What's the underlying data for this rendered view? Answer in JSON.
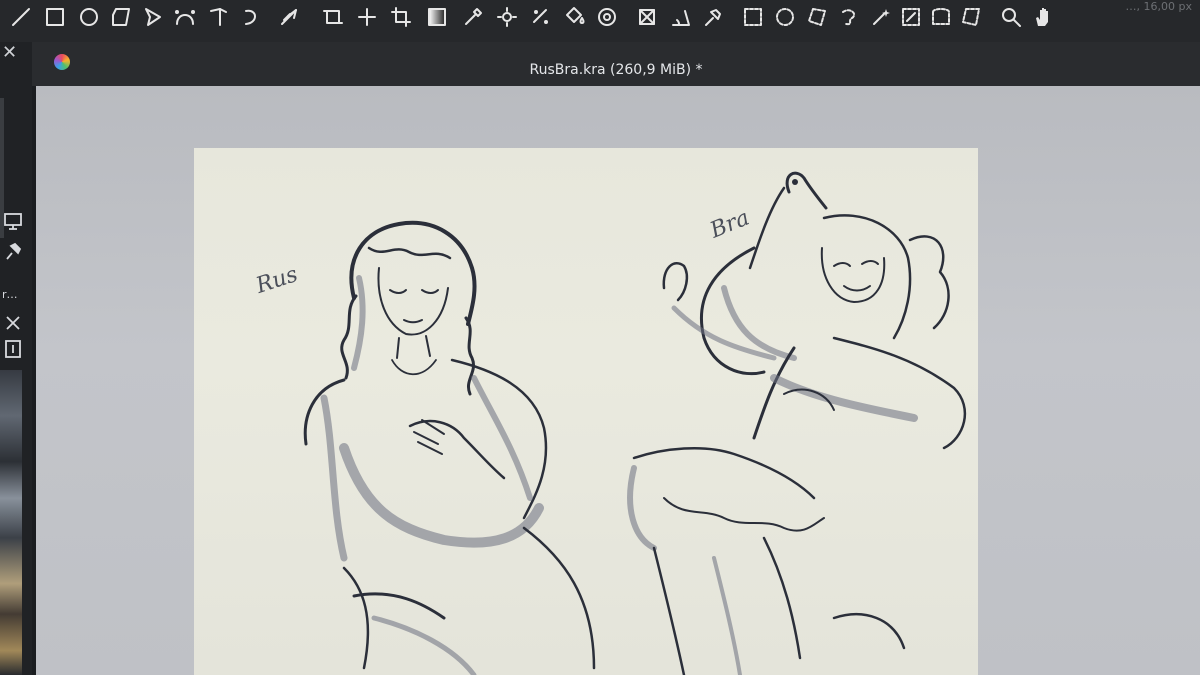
{
  "toolbar": {
    "tools": [
      {
        "name": "freehand-line-icon"
      },
      {
        "name": "rectangle-icon"
      },
      {
        "name": "ellipse-icon"
      },
      {
        "name": "polygon-icon"
      },
      {
        "name": "polyline-icon"
      },
      {
        "name": "bezier-icon"
      },
      {
        "name": "freehand-path-icon"
      },
      {
        "name": "dynamic-brush-icon"
      },
      {
        "name": "multibrush-icon"
      },
      {
        "name": "crop-icon"
      },
      {
        "name": "move-icon"
      },
      {
        "name": "transform-icon"
      },
      {
        "name": "gradient-icon"
      },
      {
        "name": "color-picker-icon"
      },
      {
        "name": "colorize-mask-icon"
      },
      {
        "name": "smart-patch-icon"
      },
      {
        "name": "fill-icon"
      },
      {
        "name": "enclose-fill-icon"
      },
      {
        "name": "assistant-icon"
      },
      {
        "name": "measure-icon"
      },
      {
        "name": "reference-icon"
      },
      {
        "name": "rect-select-icon"
      },
      {
        "name": "ellipse-select-icon"
      },
      {
        "name": "polygon-select-icon"
      },
      {
        "name": "freehand-select-icon"
      },
      {
        "name": "magic-wand-icon"
      },
      {
        "name": "similar-select-icon"
      },
      {
        "name": "bezier-select-icon"
      },
      {
        "name": "magnetic-select-icon"
      },
      {
        "name": "zoom-icon"
      },
      {
        "name": "pan-icon"
      }
    ],
    "corner_readout": "…, 16,00 px"
  },
  "document": {
    "title": "RusBra.kra (260,9 MiB) *"
  },
  "left_dock": {
    "close_glyph": "✕",
    "truncated_label": "r…",
    "panel_close_glyph": "✕"
  },
  "canvas": {
    "labels": {
      "left_name": "Rus",
      "right_name": "Bra"
    }
  },
  "colors": {
    "toolbar_bg": "#26282b",
    "canvas_bg": "#bfc1c6",
    "paper": "#e8e8de",
    "ink": "#2b2f3a"
  }
}
